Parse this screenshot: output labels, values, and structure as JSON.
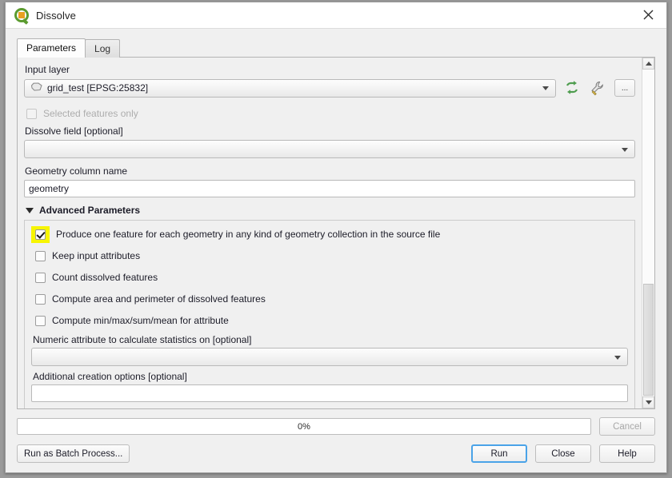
{
  "window": {
    "title": "Dissolve",
    "logo_icon": "qgis-logo",
    "close_icon": "close-icon"
  },
  "tabs": [
    {
      "label": "Parameters",
      "active": true
    },
    {
      "label": "Log",
      "active": false
    }
  ],
  "parameters": {
    "input_layer": {
      "label": "Input layer",
      "value": "grid_test [EPSG:25832]",
      "layer_icon": "polygon-layer-icon",
      "iterate_icon": "iterate-refresh-icon",
      "advanced_icon": "wrench-icon",
      "browse_label": "...",
      "dropdown_icon": "chevron-down-icon"
    },
    "selected_features_only": {
      "label": "Selected features only",
      "checked": false,
      "disabled": true
    },
    "dissolve_field": {
      "label": "Dissolve field [optional]",
      "value": "",
      "dropdown_icon": "chevron-down-icon"
    },
    "geometry_column_name": {
      "label": "Geometry column name",
      "value": "geometry"
    },
    "advanced": {
      "title": "Advanced Parameters",
      "expanded": true,
      "expander_icon": "triangle-down-icon",
      "checkboxes": [
        {
          "label": "Produce one feature for each geometry in any kind of geometry collection in the source file",
          "checked": true,
          "highlighted": true,
          "highlight_color": "#f7f500"
        },
        {
          "label": "Keep input attributes",
          "checked": false,
          "highlighted": false
        },
        {
          "label": "Count dissolved features",
          "checked": false,
          "highlighted": false
        },
        {
          "label": "Compute area and perimeter of dissolved features",
          "checked": false,
          "highlighted": false
        },
        {
          "label": "Compute min/max/sum/mean for attribute",
          "checked": false,
          "highlighted": false
        }
      ],
      "numeric_attribute": {
        "label": "Numeric attribute to calculate statistics on [optional]",
        "value": "",
        "dropdown_icon": "chevron-down-icon"
      },
      "creation_options": {
        "label": "Additional creation options [optional]",
        "value": ""
      }
    }
  },
  "footer": {
    "progress_text": "0%",
    "progress_percent": 0,
    "cancel_label": "Cancel",
    "cancel_disabled": true,
    "batch_label": "Run as Batch Process...",
    "run_label": "Run",
    "run_focused": true,
    "close_label": "Close",
    "help_label": "Help",
    "focus_color": "#4aa3e8"
  }
}
